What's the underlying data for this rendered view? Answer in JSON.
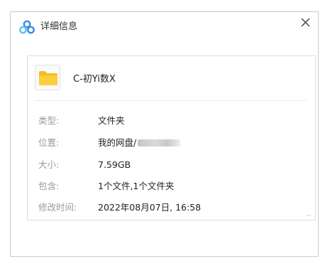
{
  "dialog": {
    "title": "详细信息",
    "app_icon": "baidu-netdisk-cloud-icon",
    "close_icon": "close-icon",
    "close_glyph": "✕"
  },
  "file": {
    "icon": "folder-icon",
    "name": "C-初Yi数X"
  },
  "details": [
    {
      "label": "类型:",
      "value": "文件夹"
    },
    {
      "label": "位置:",
      "value": "我的网盘/"
    },
    {
      "label": "大小:",
      "value": "7.59GB"
    },
    {
      "label": "包含:",
      "value": "1个文件,1个文件夹"
    },
    {
      "label": "修改时间:",
      "value": "2022年08月07日, 16:58"
    }
  ],
  "colors": {
    "folder": "#f9cf3a",
    "folder_tab": "#f2bd1f",
    "icon_blue": "#3a8ae8",
    "icon_lightblue": "#5cc3f5"
  }
}
